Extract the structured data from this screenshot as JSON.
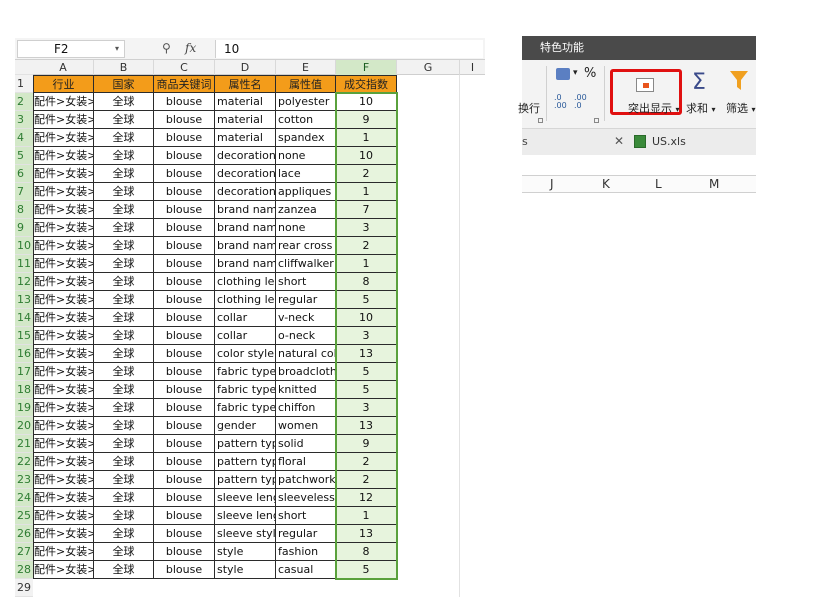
{
  "formula_bar": {
    "cell_ref": "F2",
    "dropdown_glyph": "▾",
    "zoom_glyph": "⚲",
    "fx_label": "fx",
    "value": "10"
  },
  "columns": [
    "A",
    "B",
    "C",
    "D",
    "E",
    "F",
    "G"
  ],
  "extra_column_glyph": "I",
  "headers": [
    "行业",
    "国家",
    "商品关键词",
    "属性名",
    "属性值",
    "成交指数"
  ],
  "rows": [
    [
      "配件>女装>",
      "全球",
      "blouse",
      "material",
      "polyester",
      "10"
    ],
    [
      "配件>女装>",
      "全球",
      "blouse",
      "material",
      "cotton",
      "9"
    ],
    [
      "配件>女装>",
      "全球",
      "blouse",
      "material",
      "spandex",
      "1"
    ],
    [
      "配件>女装>",
      "全球",
      "blouse",
      "decoration",
      "none",
      "10"
    ],
    [
      "配件>女装>",
      "全球",
      "blouse",
      "decoration",
      "lace",
      "2"
    ],
    [
      "配件>女装>",
      "全球",
      "blouse",
      "decoration",
      "appliques",
      "1"
    ],
    [
      "配件>女装>",
      "全球",
      "blouse",
      "brand name",
      "zanzea",
      "7"
    ],
    [
      "配件>女装>",
      "全球",
      "blouse",
      "brand name",
      "none",
      "3"
    ],
    [
      "配件>女装>",
      "全球",
      "blouse",
      "brand name",
      "rear cross",
      "2"
    ],
    [
      "配件>女装>",
      "全球",
      "blouse",
      "brand name",
      "cliffwalker",
      "1"
    ],
    [
      "配件>女装>",
      "全球",
      "blouse",
      "clothing leng",
      "short",
      "8"
    ],
    [
      "配件>女装>",
      "全球",
      "blouse",
      "clothing leng",
      "regular",
      "5"
    ],
    [
      "配件>女装>",
      "全球",
      "blouse",
      "collar",
      "v-neck",
      "10"
    ],
    [
      "配件>女装>",
      "全球",
      "blouse",
      "collar",
      "o-neck",
      "3"
    ],
    [
      "配件>女装>",
      "全球",
      "blouse",
      "color style",
      "natural colo",
      "13"
    ],
    [
      "配件>女装>",
      "全球",
      "blouse",
      "fabric type",
      "broadcloth",
      "5"
    ],
    [
      "配件>女装>",
      "全球",
      "blouse",
      "fabric type",
      "knitted",
      "5"
    ],
    [
      "配件>女装>",
      "全球",
      "blouse",
      "fabric type",
      "chiffon",
      "3"
    ],
    [
      "配件>女装>",
      "全球",
      "blouse",
      "gender",
      "women",
      "13"
    ],
    [
      "配件>女装>",
      "全球",
      "blouse",
      "pattern type",
      "solid",
      "9"
    ],
    [
      "配件>女装>",
      "全球",
      "blouse",
      "pattern type",
      "floral",
      "2"
    ],
    [
      "配件>女装>",
      "全球",
      "blouse",
      "pattern type",
      "patchwork",
      "2"
    ],
    [
      "配件>女装>",
      "全球",
      "blouse",
      "sleeve lengt",
      "sleeveless",
      "12"
    ],
    [
      "配件>女装>",
      "全球",
      "blouse",
      "sleeve lengt",
      "short",
      "1"
    ],
    [
      "配件>女装>",
      "全球",
      "blouse",
      "sleeve style",
      "regular",
      "13"
    ],
    [
      "配件>女装>",
      "全球",
      "blouse",
      "style",
      "fashion",
      "8"
    ],
    [
      "配件>女装>",
      "全球",
      "blouse",
      "style",
      "casual",
      "5"
    ]
  ],
  "row_numbers": [
    "1",
    "2",
    "3",
    "4",
    "5",
    "6",
    "7",
    "8",
    "9",
    "10",
    "11",
    "12",
    "13",
    "14",
    "15",
    "16",
    "17",
    "18",
    "19",
    "20",
    "21",
    "22",
    "23",
    "24",
    "25",
    "26",
    "27",
    "28",
    "29"
  ],
  "ribbon": {
    "tab_title": "特色功能",
    "percent_label": "%",
    "decimal_inc": ".0 .00",
    "decimal_dec": ".00 .0",
    "wrap_label": "换行",
    "highlight_label": "突出显示",
    "sum_icon": "Σ",
    "sum_label": "求和",
    "filter_label": "筛选",
    "dropdown_glyph": "▾",
    "close_glyph": "✕",
    "doc_tab_label": "US.xls"
  },
  "right_columns": [
    "J",
    "K",
    "L",
    "M"
  ],
  "colors": {
    "header_orange": "#f39c1a",
    "selection_green": "#5aa13c",
    "highlight_red": "#e01010"
  }
}
